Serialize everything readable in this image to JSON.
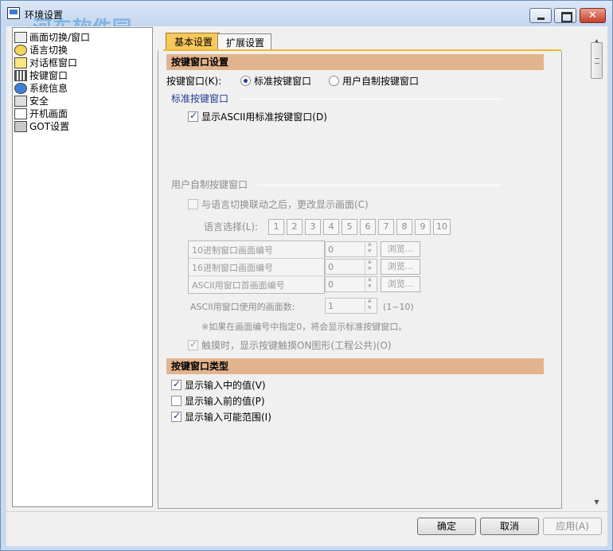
{
  "window": {
    "title": "环境设置",
    "watermark": "河东软件园",
    "watermark_url": "www.pc0359.cn"
  },
  "tree": {
    "items": [
      {
        "label": "画面切换/窗口",
        "icon": "screen-switch-icon"
      },
      {
        "label": "语言切换",
        "icon": "language-icon"
      },
      {
        "label": "对话框窗口",
        "icon": "dialog-icon"
      },
      {
        "label": "按键窗口",
        "icon": "keypad-icon"
      },
      {
        "label": "系统信息",
        "icon": "system-info-icon"
      },
      {
        "label": "安全",
        "icon": "security-icon"
      },
      {
        "label": "开机画面",
        "icon": "startup-screen-icon"
      },
      {
        "label": "GOT设置",
        "icon": "got-settings-icon"
      }
    ]
  },
  "tabs": [
    {
      "label": "基本设置",
      "active": true
    },
    {
      "label": "扩展设置",
      "active": false
    }
  ],
  "keywindow_settings": {
    "header": "按键窗口设置",
    "label": "按键窗口(K):",
    "radio_standard": "标准按键窗口",
    "radio_custom": "用户自制按键窗口",
    "standard_group": "标准按键窗口",
    "show_ascii": "显示ASCII用标准按键窗口(D)",
    "custom_group": "用户自制按键窗口",
    "lang_link": "与语言切换联动之后，更改显示画面(C)",
    "lang_select": "语言选择(L):",
    "lang_numbers": [
      "1",
      "2",
      "3",
      "4",
      "5",
      "6",
      "7",
      "8",
      "9",
      "10"
    ],
    "rows": [
      {
        "label": "10进制窗口画面编号",
        "value": "0",
        "browse": "浏览..."
      },
      {
        "label": "16进制窗口画面编号",
        "value": "0",
        "browse": "浏览..."
      },
      {
        "label": "ASCII用窗口首画面编号",
        "value": "0",
        "browse": "浏览..."
      }
    ],
    "ascii_count_label": "ASCII用窗口使用的画面数:",
    "ascii_count_value": "1",
    "ascii_count_range": "(1~10)",
    "note": "※如果在画面编号中指定0，将会显示标准按键窗口。",
    "touch_option": "触摸时，显示按键触摸ON图形(工程公共)(O)"
  },
  "keywindow_type": {
    "header": "按键窗口类型",
    "options": [
      {
        "label": "显示输入中的值(V)",
        "checked": true
      },
      {
        "label": "显示输入前的值(P)",
        "checked": false
      },
      {
        "label": "显示输入可能范围(I)",
        "checked": true
      }
    ]
  },
  "buttons": {
    "ok": "确定",
    "cancel": "取消",
    "apply": "应用(A)"
  }
}
